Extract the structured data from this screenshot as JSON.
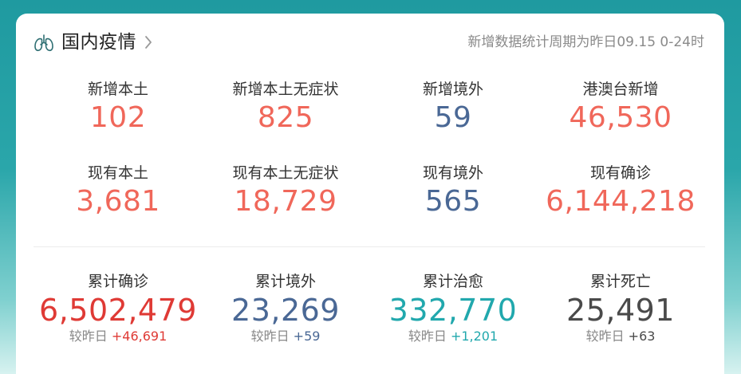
{
  "header": {
    "title": "国内疫情",
    "note": "新增数据统计周期为昨日09.15 0-24时"
  },
  "colors": {
    "red": "#f0675a",
    "blue": "#4a6895",
    "dark_red": "#df3a35",
    "teal": "#21a8ad",
    "dark": "#4a4a4a"
  },
  "row1": [
    {
      "label": "新增本土",
      "value": "102"
    },
    {
      "label": "新增本土无症状",
      "value": "825"
    },
    {
      "label": "新增境外",
      "value": "59"
    },
    {
      "label": "港澳台新增",
      "value": "46,530"
    }
  ],
  "row2": [
    {
      "label": "现有本土",
      "value": "3,681"
    },
    {
      "label": "现有本土无症状",
      "value": "18,729"
    },
    {
      "label": "现有境外",
      "value": "565"
    },
    {
      "label": "现有确诊",
      "value": "6,144,218"
    }
  ],
  "totals": [
    {
      "label": "累计确诊",
      "value": "6,502,479",
      "delta_label": "较昨日",
      "delta": "+46,691"
    },
    {
      "label": "累计境外",
      "value": "23,269",
      "delta_label": "较昨日",
      "delta": "+59"
    },
    {
      "label": "累计治愈",
      "value": "332,770",
      "delta_label": "较昨日",
      "delta": "+1,201"
    },
    {
      "label": "累计死亡",
      "value": "25,491",
      "delta_label": "较昨日",
      "delta": "+63"
    }
  ]
}
